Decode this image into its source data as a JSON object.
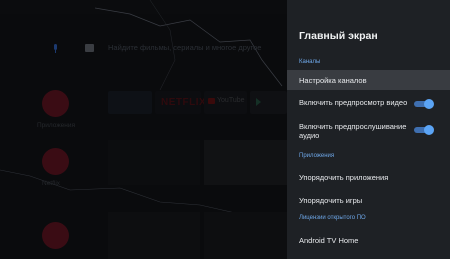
{
  "home_background": {
    "search_hint": "Найдите фильмы, сериалы и многое другое",
    "app_label_1": "Приложения",
    "app_label_2": "Netflix"
  },
  "tiles": {
    "netflix": "NETFLIX",
    "youtube": "YouTube"
  },
  "settings_panel": {
    "title": "Главный экран",
    "section_channels": "Каналы",
    "channel_setup": "Настройка каналов",
    "video_preview_label": "Включить предпросмотр видео",
    "video_preview_on": true,
    "audio_preview_label_line1": "Включить предпрослушивание",
    "audio_preview_label_line2": "аудио",
    "audio_preview_on": true,
    "section_apps": "Приложения",
    "reorder_apps": "Упорядочить приложения",
    "reorder_games": "Упорядочить игры",
    "section_licenses": "Лицензии открытого ПО",
    "android_tv_home": "Android TV Home"
  },
  "colors": {
    "panel_bg": "#1e2125",
    "highlight_bg": "#393c41",
    "section_accent": "#6ea7e8",
    "toggle_on": "#5ba4f5"
  }
}
